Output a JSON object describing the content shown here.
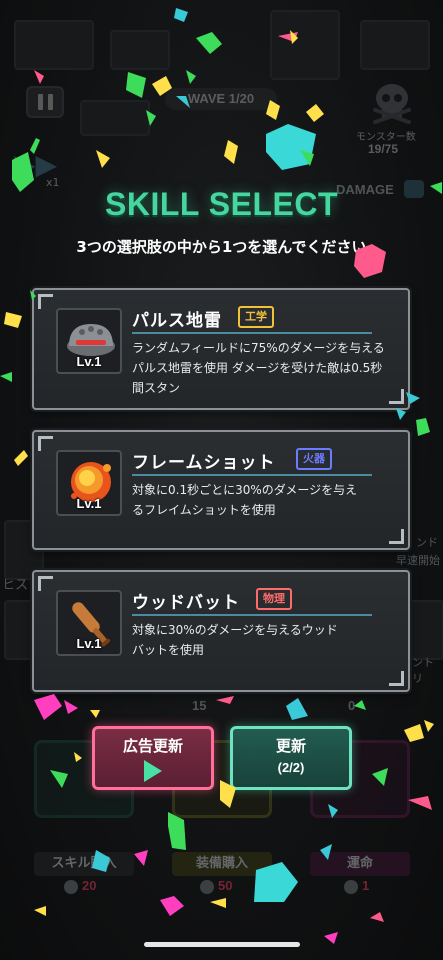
{
  "hud": {
    "wave": "WAVE 1/20",
    "speed": "x1",
    "monster_label": "モンスター数",
    "monster_count": "19/75",
    "damage_label": "DAMAGE",
    "side_right_1": "ンド",
    "side_right_2": "早速開始",
    "side_right_3": "ントリ",
    "side_left": "ヒス",
    "stat_1": "15",
    "stat_2": "0"
  },
  "overlay": {
    "title": "SKILL SELECT",
    "subtitle": "3つの選択肢の中から1つを選んでください"
  },
  "skills": [
    {
      "name": "パルス地雷",
      "tag": "工学",
      "tag_color": "#f0c23a",
      "level": "Lv.1",
      "icon": "pulse-mine-icon",
      "description": "ランダムフィールドに75%のダメージを与えるパルス地雷を使用 ダメージを受けた敵は0.5秒間スタン"
    },
    {
      "name": "フレームショット",
      "tag": "火器",
      "tag_color": "#6a7cff",
      "level": "Lv.1",
      "icon": "fireball-icon",
      "description": "対象に0.1秒ごとに30%のダメージを与えるフレイムショットを使用"
    },
    {
      "name": "ウッドバット",
      "tag": "物理",
      "tag_color": "#ff6b6b",
      "level": "Lv.1",
      "icon": "wooden-bat-icon",
      "description": "対象に30%のダメージを与えるウッドバットを使用"
    }
  ],
  "buttons": {
    "ad_refresh": "広告更新",
    "refresh": "更新",
    "refresh_count": "(2/2)"
  },
  "shop": {
    "skill_buy": "スキル購入",
    "skill_cost": "20",
    "equip_buy": "装備購入",
    "equip_cost": "50",
    "fate": "運命",
    "fate_cost": "1"
  },
  "colors": {
    "title": "#46d6a0",
    "ad_button": "#ff6f9a",
    "refresh_button": "#6fe3c0"
  }
}
